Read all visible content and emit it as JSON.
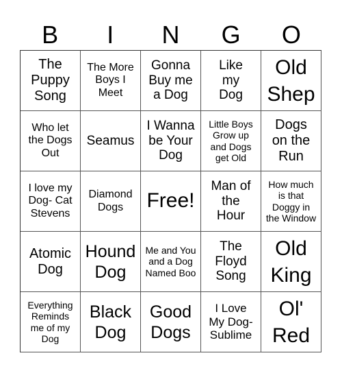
{
  "header": {
    "letters": [
      "B",
      "I",
      "N",
      "G",
      "O"
    ]
  },
  "cells": [
    "The\nPuppy\nSong",
    "The More\nBoys I\nMeet",
    "Gonna\nBuy me\na Dog",
    "Like\nmy\nDog",
    "Old\nShep",
    "Who let\nthe Dogs\nOut",
    "Seamus",
    "I Wanna\nbe Your\nDog",
    "Little Boys\nGrow up\nand Dogs\nget Old",
    "Dogs\non the\nRun",
    "I love my\nDog- Cat\nStevens",
    "Diamond\nDogs",
    "Free!",
    "Man of\nthe\nHour",
    "How much\nis that\nDoggy in\nthe Window",
    "Atomic\nDog",
    "Hound\nDog",
    "Me and You\nand a Dog\nNamed Boo",
    "The\nFloyd\nSong",
    "Old\nKing",
    "Everything\nReminds\nme of my\nDog",
    "Black\nDog",
    "Good\nDogs",
    "I Love\nMy Dog-\nSublime",
    "Ol'\nRed"
  ]
}
